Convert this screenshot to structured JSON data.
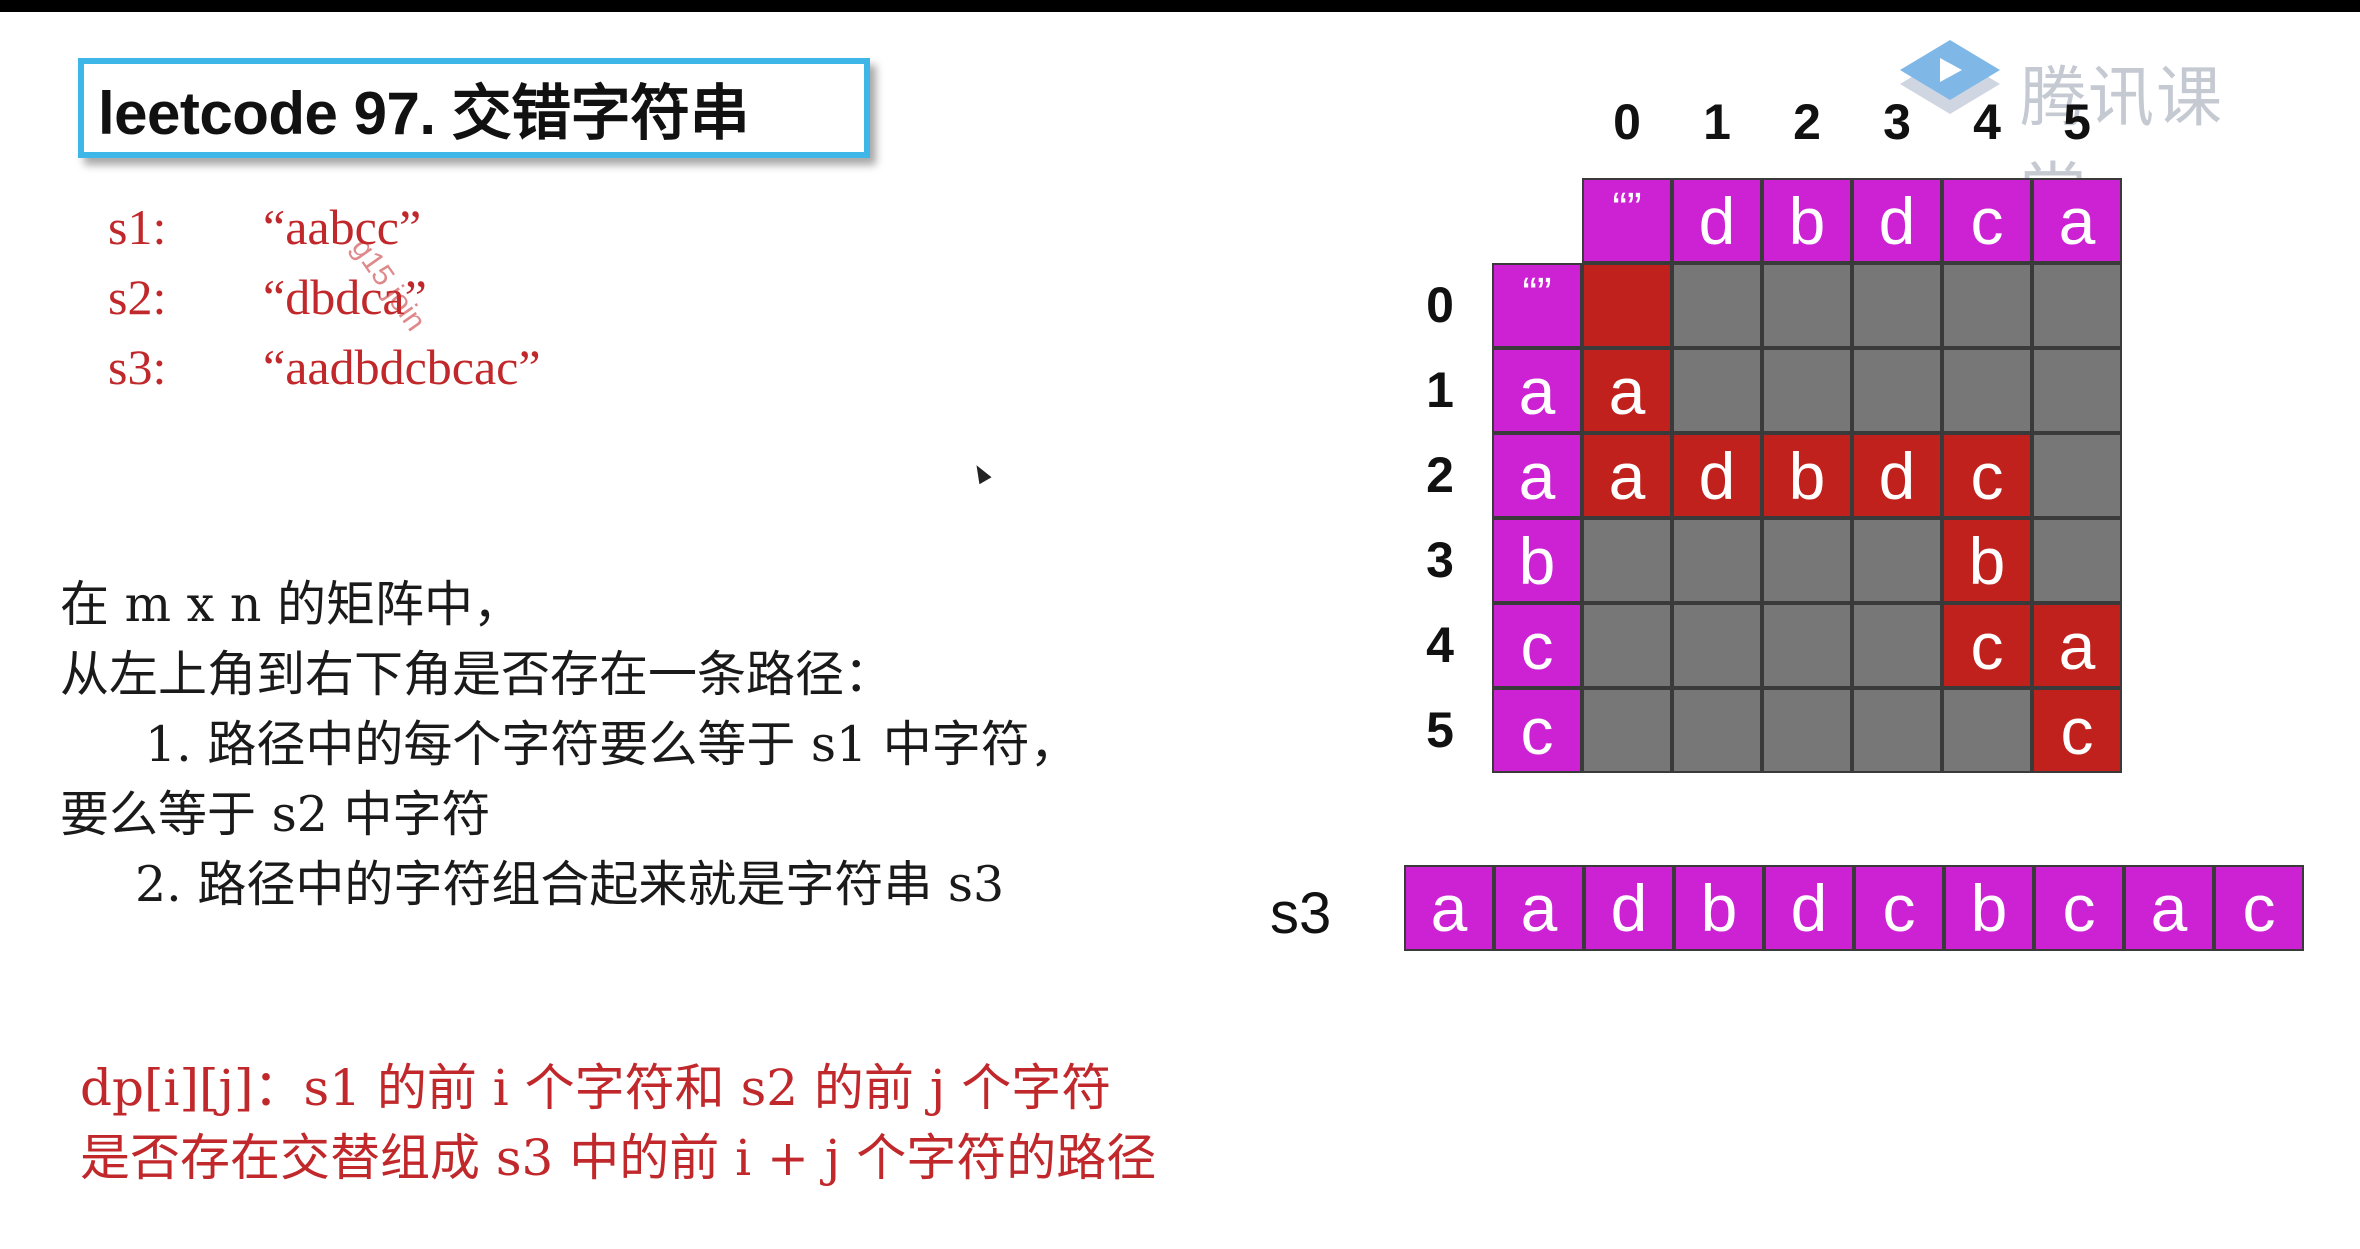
{
  "title": "leetcode 97. 交错字符串",
  "strings": [
    {
      "label": "s1:",
      "value": "“aabcc”"
    },
    {
      "label": "s2:",
      "value": "“dbdca”"
    },
    {
      "label": "s3:",
      "value": "“aadbdcbcac”"
    }
  ],
  "watermark": "g15 join",
  "description": [
    "在 m x n 的矩阵中，",
    "从左上角到右下角是否存在一条路径：",
    "1. 路径中的每个字符要么等于 s1 中字符，",
    "要么等于 s2 中字符",
    "2. 路径中的字符组合起来就是字符串 s3"
  ],
  "dp_definition": [
    "dp[i][j]：s1 的前 i 个字符和 s2 的前 j 个字符",
    "是否存在交替组成 s3 中的前 i + j 个字符的路径"
  ],
  "logo_text": "腾讯课堂",
  "grid": {
    "col_indices": [
      "0",
      "1",
      "2",
      "3",
      "4",
      "5"
    ],
    "row_indices": [
      "0",
      "1",
      "2",
      "3",
      "4",
      "5"
    ],
    "empty_label": "“”",
    "header_row": [
      "d",
      "b",
      "d",
      "c",
      "a"
    ],
    "header_col": [
      "a",
      "a",
      "b",
      "c",
      "c"
    ],
    "cells": [
      [
        "",
        "",
        "",
        "",
        "",
        ""
      ],
      [
        "a",
        "",
        "",
        "",
        "",
        ""
      ],
      [
        "a",
        "d",
        "b",
        "d",
        "c",
        ""
      ],
      [
        "",
        "",
        "",
        "",
        "b",
        ""
      ],
      [
        "",
        "",
        "",
        "",
        "c",
        "a"
      ],
      [
        "",
        "",
        "",
        "",
        "",
        "c"
      ]
    ],
    "path": [
      [
        0,
        0
      ],
      [
        1,
        0
      ],
      [
        2,
        0
      ],
      [
        2,
        1
      ],
      [
        2,
        2
      ],
      [
        2,
        3
      ],
      [
        2,
        4
      ],
      [
        3,
        4
      ],
      [
        4,
        4
      ],
      [
        4,
        5
      ],
      [
        5,
        5
      ]
    ]
  },
  "s3_row": {
    "label": "s3",
    "chars": [
      "a",
      "a",
      "d",
      "b",
      "d",
      "c",
      "b",
      "c",
      "a",
      "c"
    ]
  },
  "colors": {
    "header": "#cc22d4",
    "path": "#c1211c",
    "empty": "#777777",
    "accent_text": "#c1282b",
    "title_border": "#3fb6e8"
  }
}
